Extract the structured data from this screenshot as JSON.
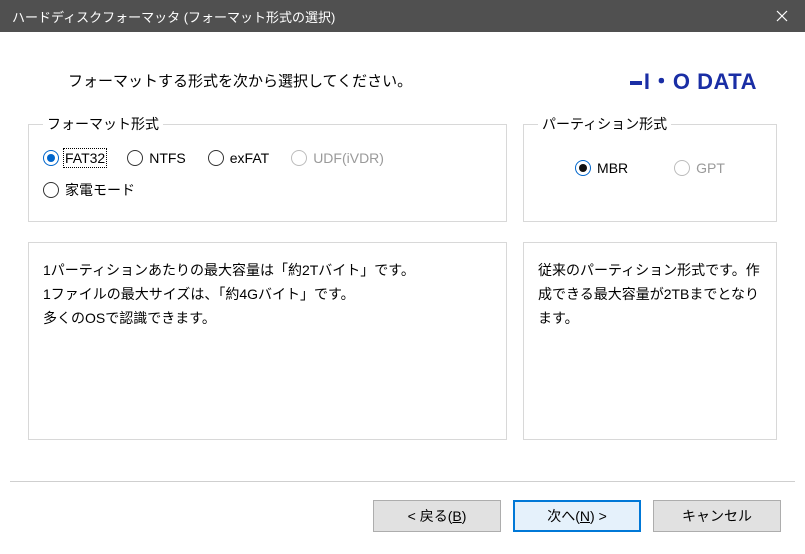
{
  "titlebar": {
    "title": "ハードディスクフォーマッタ (フォーマット形式の選択)"
  },
  "brand": "I・O DATA",
  "instruction": "フォーマットする形式を次から選択してください。",
  "format": {
    "legend": "フォーマット形式",
    "options": {
      "fat32": "FAT32",
      "ntfs": "NTFS",
      "exfat": "exFAT",
      "udf": "UDF(iVDR)",
      "kaden": "家電モード"
    }
  },
  "partition": {
    "legend": "パーティション形式",
    "options": {
      "mbr": "MBR",
      "gpt": "GPT"
    }
  },
  "desc": {
    "format": "1パーティションあたりの最大容量は「約2Tバイト」です。\n1ファイルの最大サイズは、「約4Gバイト」です。\n多くのOSで認識できます。",
    "partition": "従来のパーティション形式です。作成できる最大容量が2TBまでとなります。"
  },
  "buttons": {
    "back_pre": "< 戻る(",
    "back_mn": "B",
    "back_post": ")",
    "next_pre": "次へ(",
    "next_mn": "N",
    "next_post": ") >",
    "cancel": "キャンセル"
  }
}
